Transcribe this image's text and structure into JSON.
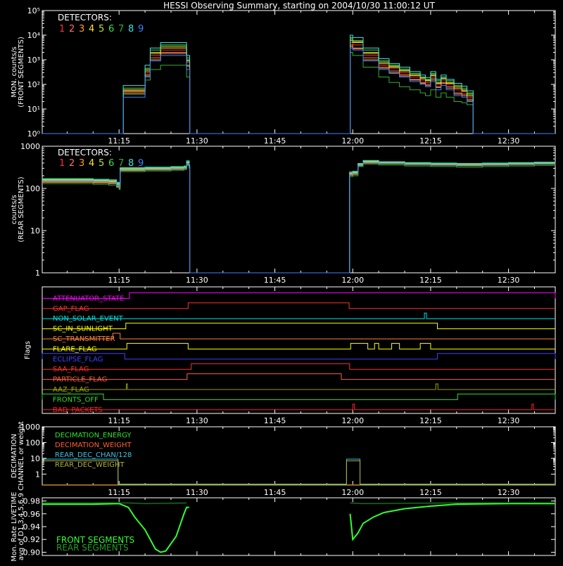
{
  "title": "HESSI Observing Summary, starting on 2004/10/30 11:00:12 UT",
  "detectors_label": "DETECTORS:",
  "detector_colors": [
    "#ff3030",
    "#ff7060",
    "#ff9a3a",
    "#ffe040",
    "#c0e040",
    "#40e040",
    "#30b030",
    "#40e0e0",
    "#4080ff"
  ],
  "time_ticks": [
    "11:15",
    "11:30",
    "11:45",
    "12:00",
    "12:15",
    "12:30"
  ],
  "time_tick_minutes": [
    15,
    30,
    45,
    60,
    75,
    90
  ],
  "time_range_minutes": [
    0.2,
    99.0
  ],
  "chart_data": [
    {
      "type": "line",
      "panel": "front",
      "ylabel_lines": [
        "MON. counts/s",
        "(FRONT SEGMENTS)"
      ],
      "yscale": "log",
      "ylim": [
        1,
        100000
      ],
      "ytick_values": [
        1,
        10,
        100,
        1000,
        10000,
        100000
      ],
      "ytick_labels": [
        "10⁰",
        "10¹",
        "10²",
        "10³",
        "10⁴",
        "10⁵"
      ],
      "series_labels": [
        "1",
        "2",
        "3",
        "4",
        "5",
        "6",
        "7",
        "8",
        "9"
      ],
      "x_minutes": [
        15.8,
        17.0,
        19.0,
        20.0,
        21.0,
        23.0,
        26.0,
        28.0,
        28.5,
        59.5,
        60.0,
        62.0,
        65.0,
        67.0,
        69.0,
        71.0,
        73.0,
        74.0,
        75.0,
        76.0,
        77.0,
        78.0,
        79.5,
        81.0,
        82.0,
        83.0
      ],
      "series": [
        {
          "values": [
            50,
            50,
            50,
            300,
            1500,
            2500,
            2500,
            800,
            800,
            5000,
            4000,
            1500,
            600,
            450,
            300,
            200,
            150,
            120,
            200,
            100,
            150,
            100,
            60,
            50,
            30,
            30
          ]
        },
        {
          "values": [
            45,
            45,
            45,
            250,
            1200,
            2000,
            2000,
            600,
            600,
            4000,
            3000,
            1200,
            500,
            350,
            250,
            160,
            120,
            100,
            170,
            80,
            120,
            80,
            45,
            40,
            25,
            25
          ]
        },
        {
          "values": [
            40,
            40,
            40,
            220,
            1000,
            1800,
            1800,
            550,
            550,
            3500,
            2800,
            1000,
            450,
            300,
            220,
            150,
            110,
            90,
            150,
            75,
            110,
            70,
            40,
            35,
            22,
            22
          ]
        },
        {
          "values": [
            55,
            55,
            55,
            350,
            1800,
            3000,
            3000,
            900,
            900,
            6000,
            5000,
            1800,
            700,
            500,
            350,
            230,
            170,
            140,
            230,
            110,
            170,
            110,
            70,
            55,
            35,
            35
          ]
        },
        {
          "values": [
            60,
            60,
            60,
            400,
            2000,
            3500,
            3500,
            1000,
            1000,
            7000,
            5500,
            2000,
            800,
            550,
            380,
            250,
            190,
            150,
            250,
            120,
            180,
            120,
            80,
            60,
            40,
            40
          ]
        },
        {
          "values": [
            70,
            70,
            70,
            450,
            2500,
            4000,
            4000,
            1200,
            1200,
            8000,
            6000,
            2500,
            900,
            600,
            420,
            280,
            200,
            160,
            280,
            140,
            200,
            140,
            90,
            70,
            45,
            45
          ]
        },
        {
          "values": [
            40,
            40,
            40,
            150,
            400,
            600,
            600,
            200,
            200,
            2000,
            1500,
            500,
            200,
            120,
            80,
            60,
            45,
            35,
            60,
            30,
            45,
            30,
            20,
            18,
            15,
            15
          ]
        },
        {
          "values": [
            90,
            90,
            90,
            600,
            3000,
            5000,
            5000,
            1500,
            1500,
            10000,
            8000,
            3000,
            1100,
            700,
            500,
            330,
            240,
            190,
            330,
            160,
            240,
            160,
            110,
            85,
            55,
            55
          ]
        },
        {
          "values": [
            30,
            30,
            30,
            200,
            900,
            1500,
            1500,
            400,
            400,
            3000,
            2500,
            900,
            400,
            280,
            200,
            130,
            100,
            80,
            130,
            60,
            90,
            60,
            35,
            30,
            20,
            20
          ]
        }
      ]
    },
    {
      "type": "line",
      "panel": "rear",
      "ylabel_lines": [
        "counts/s",
        "(REAR SEGMENTS)"
      ],
      "yscale": "log",
      "ylim": [
        1,
        1000
      ],
      "ytick_values": [
        1,
        10,
        100,
        1000
      ],
      "ytick_labels": [
        "1",
        "10",
        "100",
        "1000"
      ],
      "series_labels": [
        "1",
        "2",
        "3",
        "4",
        "5",
        "6",
        "7",
        "8",
        "9"
      ],
      "x_minutes": [
        0.2,
        5.0,
        10.0,
        13.0,
        14.5,
        15.0,
        15.2,
        20.0,
        25.0,
        27.5,
        28.0,
        28.5,
        59.5,
        60.0,
        60.8,
        61.0,
        62.0,
        65.0,
        70.0,
        75.0,
        80.0,
        85.0,
        90.0,
        95.0,
        99.0
      ],
      "series": [
        {
          "values": [
            150,
            150,
            145,
            140,
            120,
            110,
            280,
            290,
            300,
            310,
            400,
            330,
            220,
            230,
            230,
            360,
            420,
            400,
            380,
            370,
            360,
            370,
            380,
            390,
            400
          ]
        },
        {
          "values": [
            145,
            145,
            140,
            135,
            115,
            105,
            270,
            280,
            290,
            300,
            380,
            320,
            210,
            220,
            220,
            350,
            410,
            390,
            370,
            360,
            350,
            360,
            370,
            380,
            390
          ]
        },
        {
          "values": [
            140,
            140,
            135,
            130,
            110,
            100,
            265,
            275,
            285,
            295,
            370,
            310,
            205,
            215,
            215,
            345,
            400,
            385,
            365,
            355,
            345,
            355,
            365,
            375,
            385
          ]
        },
        {
          "values": [
            155,
            155,
            150,
            145,
            125,
            115,
            285,
            295,
            305,
            315,
            410,
            335,
            225,
            235,
            235,
            365,
            430,
            405,
            385,
            375,
            365,
            375,
            385,
            395,
            405
          ]
        },
        {
          "values": [
            160,
            160,
            155,
            150,
            130,
            120,
            290,
            300,
            310,
            320,
            420,
            340,
            230,
            240,
            240,
            370,
            440,
            410,
            390,
            380,
            370,
            380,
            390,
            400,
            410
          ]
        },
        {
          "values": [
            165,
            165,
            160,
            155,
            135,
            125,
            300,
            310,
            320,
            330,
            430,
            350,
            235,
            245,
            245,
            380,
            450,
            420,
            400,
            390,
            380,
            390,
            400,
            410,
            420
          ]
        },
        {
          "values": [
            130,
            130,
            125,
            120,
            105,
            95,
            250,
            260,
            270,
            280,
            350,
            300,
            190,
            200,
            200,
            330,
            380,
            360,
            340,
            330,
            320,
            330,
            340,
            350,
            360
          ]
        },
        {
          "values": [
            170,
            170,
            165,
            160,
            140,
            130,
            310,
            320,
            330,
            340,
            450,
            360,
            245,
            255,
            255,
            390,
            460,
            430,
            410,
            400,
            390,
            400,
            410,
            420,
            430
          ]
        },
        {
          "values": [
            150,
            150,
            145,
            140,
            120,
            110,
            275,
            285,
            295,
            305,
            390,
            325,
            215,
            225,
            225,
            355,
            415,
            395,
            375,
            365,
            355,
            365,
            375,
            385,
            395
          ]
        }
      ]
    },
    {
      "type": "flags",
      "panel": "flags",
      "ylabel": "Flags",
      "flags": [
        {
          "name": "ATTENUATOR_STATE",
          "color": "#ff00ff",
          "on_intervals": [
            [
              17.0,
              99.0
            ]
          ]
        },
        {
          "name": "GAP_FLAG",
          "color": "#ff3030",
          "on_intervals": [
            [
              28.3,
              59.3
            ]
          ]
        },
        {
          "name": "NON_SOLAR_EVENT",
          "color": "#00e0e0",
          "on_intervals": [
            [
              73.8,
              74.2
            ]
          ]
        },
        {
          "name": "SC_IN_SUNLIGHT",
          "color": "#ffff00",
          "on_intervals": [
            [
              16.3,
              76.3
            ]
          ]
        },
        {
          "name": "SC_TRANSMITTER",
          "color": "#ff8040",
          "on_intervals": [
            [
              13.8,
              15.2
            ]
          ]
        },
        {
          "name": "FLARE_FLAG",
          "color": "#ffff00",
          "on_intervals": [
            [
              16.5,
              28.3
            ],
            [
              59.6,
              62.9
            ],
            [
              64.2,
              65.0
            ],
            [
              67.5,
              69.0
            ],
            [
              73.0,
              75.0
            ]
          ]
        },
        {
          "name": "ECLIPSE_FLAG",
          "color": "#4040ff",
          "on_intervals": [
            [
              0.2,
              16.1
            ],
            [
              76.3,
              99.0
            ]
          ]
        },
        {
          "name": "SAA_FLAG",
          "color": "#ff3030",
          "on_intervals": [
            [
              28.9,
              59.4
            ]
          ]
        },
        {
          "name": "PARTICLE_FLAG",
          "color": "#ff6040",
          "on_intervals": [
            [
              28.1,
              57.8
            ]
          ]
        },
        {
          "name": "AAZ_FLAG",
          "color": "#a0a000",
          "on_intervals": [
            [
              16.4,
              16.6
            ],
            [
              76.0,
              76.4
            ]
          ]
        },
        {
          "name": "FRONTS_OFF",
          "color": "#30e030",
          "on_intervals": [
            [
              0.2,
              12.0
            ],
            [
              80.2,
              99.0
            ]
          ]
        },
        {
          "name": "BAD_PACKETS",
          "color": "#ff2020",
          "on_intervals": [
            [
              60.0,
              60.3
            ],
            [
              94.5,
              94.8
            ]
          ]
        }
      ]
    },
    {
      "type": "line",
      "panel": "decimation",
      "ylabel_lines": [
        "DECIMATION",
        "CHANNEL or weight"
      ],
      "yscale": "log",
      "ylim": [
        0.2,
        1000
      ],
      "ytick_values": [
        1,
        10,
        100,
        1000
      ],
      "ytick_labels": [
        "1",
        "10",
        "100",
        "1000"
      ],
      "series": [
        {
          "name": "DECIMATION_ENERGY",
          "color": "#30e030",
          "x_minutes": [
            0.2,
            99.0
          ],
          "values": [
            0.2,
            0.2
          ]
        },
        {
          "name": "DECIMATION_WEIGHT",
          "color": "#ff6030",
          "x_minutes": [
            0.2,
            99.0
          ],
          "values": [
            0.2,
            0.2
          ]
        },
        {
          "name": "REAR_DEC_CHAN/128",
          "color": "#40c0e0",
          "x_minutes": [
            0.2,
            14.8,
            14.8,
            58.8,
            58.8,
            61.4,
            61.4,
            99.0
          ],
          "values": [
            8,
            8,
            0.2,
            0.2,
            8,
            8,
            0.2,
            0.2
          ]
        },
        {
          "name": "REAR_DEC_WEIGHT",
          "color": "#b0b040",
          "x_minutes": [
            0.2,
            14.8,
            14.8,
            58.8,
            58.8,
            61.4,
            61.4,
            99.0
          ],
          "values": [
            6,
            6,
            0.2,
            0.2,
            6,
            6,
            0.2,
            0.2
          ]
        }
      ]
    },
    {
      "type": "line",
      "panel": "livetime",
      "ylabel_lines": [
        "Mon. Rate LIVETIME",
        "avg of D1,3,4,5,6,9"
      ],
      "ylim": [
        0.895,
        0.985
      ],
      "ytick_values": [
        0.9,
        0.92,
        0.94,
        0.96,
        0.98
      ],
      "ytick_labels": [
        "0.90",
        "0.92",
        "0.94",
        "0.96",
        "0.98"
      ],
      "series": [
        {
          "name": "FRONT SEGMENTS",
          "color": "#30ff30",
          "x_minutes": [
            0.2,
            10.0,
            15.0,
            16.8,
            18.0,
            20.0,
            22.0,
            23.0,
            24.0,
            26.0,
            27.5,
            28.0,
            28.5,
            59.5,
            60.0,
            61.0,
            62.0,
            64.0,
            66.0,
            70.0,
            75.0,
            80.0,
            90.0,
            99.0
          ],
          "values": [
            0.975,
            0.975,
            0.976,
            0.97,
            0.955,
            0.935,
            0.905,
            0.9,
            0.902,
            0.925,
            0.96,
            0.97,
            0.97,
            0.96,
            0.92,
            0.93,
            0.945,
            0.955,
            0.962,
            0.968,
            0.972,
            0.975,
            0.976,
            0.976
          ]
        },
        {
          "name": "REAR SEGMENTS",
          "color": "#20a020",
          "x_minutes": [
            0.2,
            16.8,
            20.0,
            28.0,
            59.5,
            62.0,
            80.0,
            99.0
          ],
          "values": [
            0.977,
            0.977,
            0.976,
            0.977,
            0.977,
            0.976,
            0.977,
            0.977
          ]
        }
      ]
    }
  ]
}
